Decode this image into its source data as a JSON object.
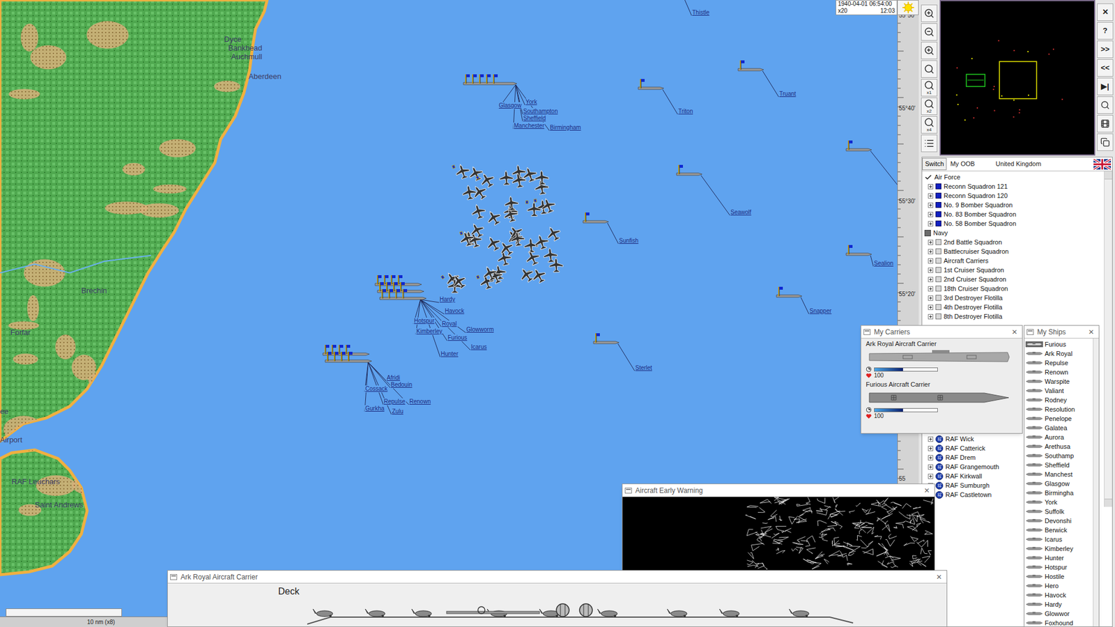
{
  "clock": {
    "datetime": "1940-04-01 06:54:00",
    "speed": "x20",
    "time": "12:03"
  },
  "latitude_labels": [
    "55°50'",
    "55°40'",
    "55°30'",
    "55°20'",
    "55"
  ],
  "place_labels": [
    "Dyce",
    "Bankhead",
    "Auchmull",
    "Aberdeen",
    "Brechin",
    "Forfar",
    "ee",
    "Airport",
    "RAF Leuchars",
    "Saint Andrews"
  ],
  "units": [
    {
      "labels": [
        "Thistle"
      ]
    },
    {
      "labels": [
        "York",
        "Glasgow",
        "Southampton",
        "Sheffield",
        "Manchester",
        "Birmingham"
      ]
    },
    {
      "labels": [
        "Triton"
      ]
    },
    {
      "labels": [
        "Truant"
      ]
    },
    {
      "labels": []
    },
    {
      "labels": [
        "Seawolf"
      ]
    },
    {
      "labels": [
        "Sunfish"
      ]
    },
    {
      "labels": [
        "Sealion"
      ]
    },
    {
      "labels": [
        "Snapper"
      ]
    },
    {
      "labels": [
        "Sterlet"
      ]
    },
    {
      "labels": [
        "Hardy",
        "Havock",
        "Hotspur",
        "Royal",
        "Kimberley",
        "Furious",
        "Glowworm",
        "Icarus",
        "Hunter"
      ]
    },
    {
      "labels": [
        "Afridi",
        "Bedouin",
        "Cossack",
        "Repulse",
        "Renown",
        "Gurkha",
        "Zulu"
      ]
    }
  ],
  "scale": "10 nm (x8)",
  "toolbar": [
    {
      "kind": "zoom-in"
    },
    {
      "kind": "zoom-out"
    },
    {
      "kind": "zoom-in"
    },
    {
      "kind": "search"
    },
    {
      "kind": "search",
      "label": "x1"
    },
    {
      "kind": "search",
      "label": "x2"
    },
    {
      "kind": "search",
      "label": "x4"
    },
    {
      "kind": "list"
    }
  ],
  "side_buttons": [
    "✕",
    "?",
    ">>",
    "<<",
    "▶|"
  ],
  "oob": {
    "switch": "Switch",
    "tab": "My OOB",
    "nation": "United Kingdom",
    "items": [
      {
        "label": "Air Force",
        "kind": "branch",
        "checked": true
      },
      {
        "label": "Reconn Squadron 121",
        "kind": "air"
      },
      {
        "label": "Reconn Squadron 120",
        "kind": "air"
      },
      {
        "label": "No. 9 Bomber Squadron",
        "kind": "air"
      },
      {
        "label": "No. 83 Bomber Squadron",
        "kind": "air"
      },
      {
        "label": "No. 58 Bomber Squadron",
        "kind": "air"
      },
      {
        "label": "Navy",
        "kind": "branch",
        "checked": false
      },
      {
        "label": "2nd Battle Squadron",
        "kind": "navy"
      },
      {
        "label": "Battlecruiser Squadron",
        "kind": "navy"
      },
      {
        "label": "Aircraft Carriers",
        "kind": "navy"
      },
      {
        "label": "1st Cruiser Squadron",
        "kind": "navy"
      },
      {
        "label": "2nd Cruiser Squadron",
        "kind": "navy"
      },
      {
        "label": "18th Cruiser Squadron",
        "kind": "navy"
      },
      {
        "label": "3rd Destroyer Flotilla",
        "kind": "navy"
      },
      {
        "label": "4th Destroyer Flotilla",
        "kind": "navy"
      },
      {
        "label": "8th Destroyer Flotilla",
        "kind": "navy"
      }
    ],
    "bases": [
      "RAF Wick",
      "RAF Catterick",
      "RAF Drem",
      "RAF Grangemouth",
      "RAF Kirkwall",
      "RAF Sumburgh",
      "RAF Castletown"
    ]
  },
  "carriers_window": {
    "title": "My Carriers",
    "close": "✕",
    "carriers": [
      {
        "name": "Ark Royal Aircraft Carrier",
        "level": 0.45,
        "health": "100"
      },
      {
        "name": "Furious Aircraft Carrier",
        "level": 0.45,
        "health": "100"
      }
    ]
  },
  "ships_window": {
    "title": "My Ships",
    "close": "✕",
    "ships": [
      {
        "name": "Furious",
        "selected": true
      },
      {
        "name": "Ark Royal",
        "selected": false
      },
      {
        "name": "Repulse",
        "selected": false
      },
      {
        "name": "Renown",
        "selected": false
      },
      {
        "name": "Warspite",
        "selected": false
      },
      {
        "name": "Valiant",
        "selected": false
      },
      {
        "name": "Rodney",
        "selected": false
      },
      {
        "name": "Resolution",
        "selected": false
      },
      {
        "name": "Penelope",
        "selected": false
      },
      {
        "name": "Galatea",
        "selected": false
      },
      {
        "name": "Aurora",
        "selected": false
      },
      {
        "name": "Arethusa",
        "selected": false
      },
      {
        "name": "Southamp",
        "selected": false
      },
      {
        "name": "Sheffield",
        "selected": false
      },
      {
        "name": "Manchest",
        "selected": false
      },
      {
        "name": "Glasgow",
        "selected": false
      },
      {
        "name": "Birmingha",
        "selected": false
      },
      {
        "name": "York",
        "selected": false
      },
      {
        "name": "Suffolk",
        "selected": false
      },
      {
        "name": "Devonshi",
        "selected": false
      },
      {
        "name": "Berwick",
        "selected": false
      },
      {
        "name": "Icarus",
        "selected": false
      },
      {
        "name": "Kimberley",
        "selected": false
      },
      {
        "name": "Hunter",
        "selected": false
      },
      {
        "name": "Hotspur",
        "selected": false
      },
      {
        "name": "Hostile",
        "selected": false
      },
      {
        "name": "Hero",
        "selected": false
      },
      {
        "name": "Havock",
        "selected": false
      },
      {
        "name": "Hardy",
        "selected": false
      },
      {
        "name": "Glowwor",
        "selected": false
      },
      {
        "name": "Foxhound",
        "selected": false
      }
    ]
  },
  "early_warning": {
    "title": "Aircraft Early Warning",
    "close": "✕"
  },
  "deck_window": {
    "title": "Ark Royal Aircraft Carrier",
    "close": "✕",
    "deck_label": "Deck"
  }
}
